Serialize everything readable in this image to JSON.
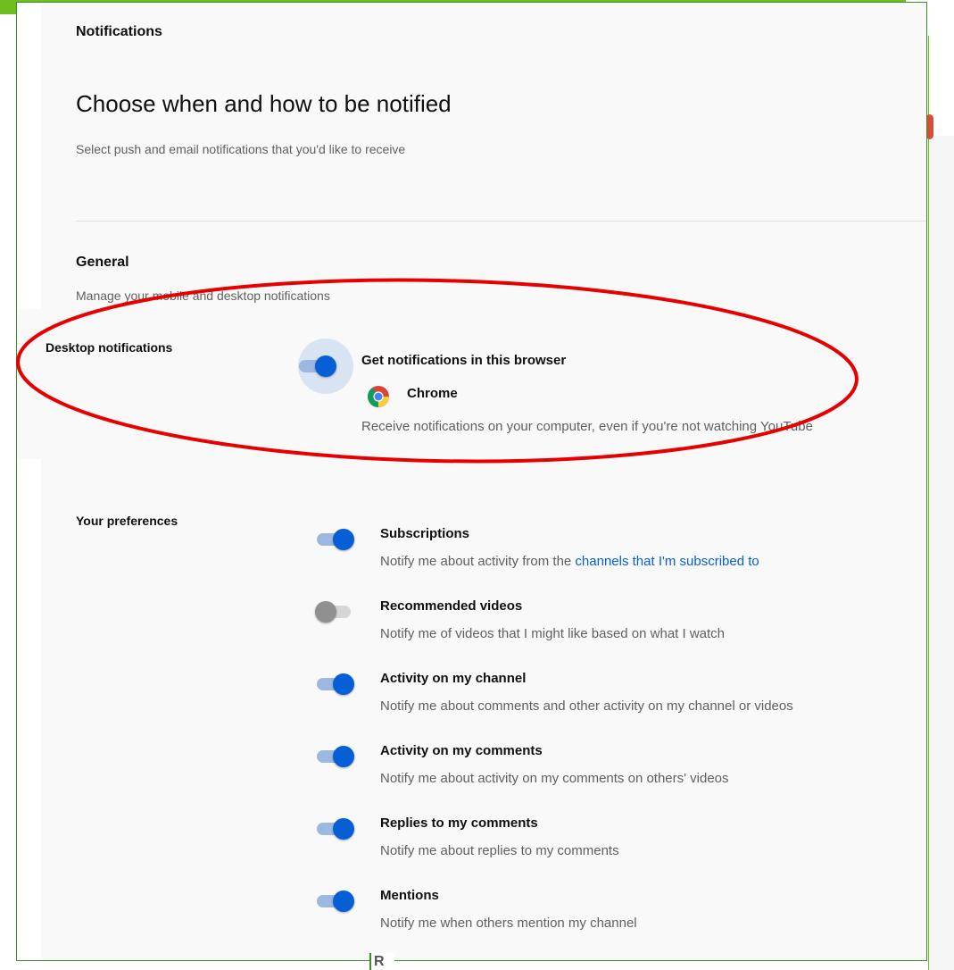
{
  "header": {
    "title": "Notifications"
  },
  "page": {
    "heading": "Choose when and how to be notified",
    "subheading": "Select push and email notifications that you'd like to receive"
  },
  "general": {
    "title": "General",
    "subtitle": "Manage your mobile and desktop notifications"
  },
  "desktop": {
    "label": "Desktop notifications",
    "toggle_on": true,
    "title": "Get notifications in this browser",
    "browser_icon": "chrome-icon",
    "browser_name": "Chrome",
    "description": "Receive notifications on your computer, even if you're not watching YouTube"
  },
  "preferences": {
    "label": "Your preferences",
    "items": [
      {
        "title": "Subscriptions",
        "enabled": true,
        "desc": "Notify me about activity from the ",
        "link": "channels that I'm subscribed to"
      },
      {
        "title": "Recommended videos",
        "enabled": false,
        "desc": "Notify me of videos that I might like based on what I watch",
        "link": ""
      },
      {
        "title": "Activity on my channel",
        "enabled": true,
        "desc": "Notify me about comments and other activity on my channel or videos",
        "link": ""
      },
      {
        "title": "Activity on my comments",
        "enabled": true,
        "desc": "Notify me about activity on my comments on others' videos",
        "link": ""
      },
      {
        "title": "Replies to my comments",
        "enabled": true,
        "desc": "Notify me about replies to my comments",
        "link": ""
      },
      {
        "title": "Mentions",
        "enabled": true,
        "desc": "Notify me when others mention my channel",
        "link": ""
      }
    ]
  },
  "footer_fragment": "R",
  "colors": {
    "accent": "#065fd4",
    "annotation": "#e60000",
    "frame": "#3a8f2a",
    "banner": "#6fbe1f"
  }
}
